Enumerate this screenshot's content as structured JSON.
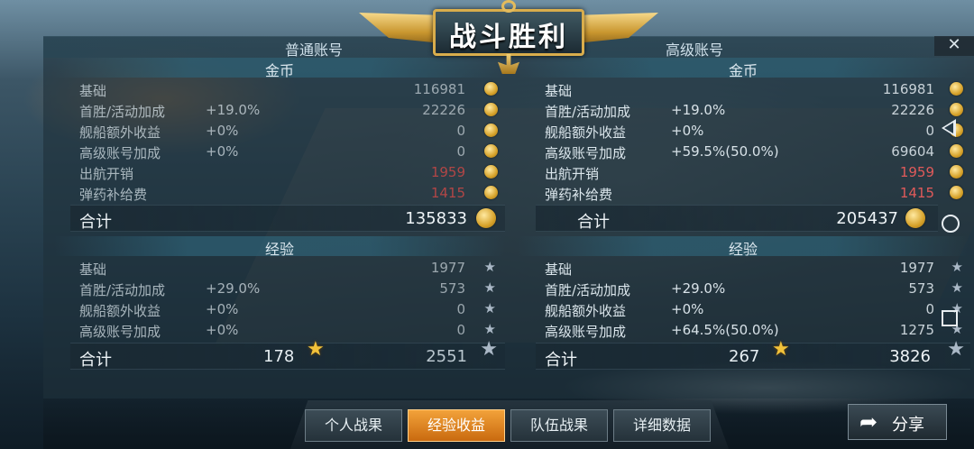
{
  "header": {
    "title": "战斗胜利",
    "normal_account": "普通账号",
    "premium_account": "高级账号",
    "close": "✕"
  },
  "gold": {
    "section": "金币",
    "normal": {
      "rows": [
        {
          "label": "基础",
          "pct": "",
          "value": "116981"
        },
        {
          "label": "首胜/活动加成",
          "pct": "+19.0%",
          "value": "22226"
        },
        {
          "label": "舰船额外收益",
          "pct": "+0%",
          "value": "0"
        },
        {
          "label": "高级账号加成",
          "pct": "+0%",
          "value": "0"
        },
        {
          "label": "出航开销",
          "pct": "",
          "value": "1959"
        },
        {
          "label": "弹药补给费",
          "pct": "",
          "value": "1415"
        }
      ],
      "total_label": "合计",
      "total": "135833"
    },
    "premium": {
      "rows": [
        {
          "label": "基础",
          "pct": "",
          "value": "116981"
        },
        {
          "label": "首胜/活动加成",
          "pct": "+19.0%",
          "value": "22226"
        },
        {
          "label": "舰船额外收益",
          "pct": "+0%",
          "value": "0"
        },
        {
          "label": "高级账号加成",
          "pct": "+59.5%(50.0%)",
          "value": "69604"
        },
        {
          "label": "出航开销",
          "pct": "",
          "value": "1959"
        },
        {
          "label": "弹药补给费",
          "pct": "",
          "value": "1415"
        }
      ],
      "total_label": "合计",
      "total": "205437"
    }
  },
  "exp": {
    "section": "经验",
    "normal": {
      "rows": [
        {
          "label": "基础",
          "pct": "",
          "value": "1977"
        },
        {
          "label": "首胜/活动加成",
          "pct": "+29.0%",
          "value": "573"
        },
        {
          "label": "舰船额外收益",
          "pct": "+0%",
          "value": "0"
        },
        {
          "label": "高级账号加成",
          "pct": "+0%",
          "value": "0"
        }
      ],
      "total_label": "合计",
      "captain_exp": "178",
      "total": "2551"
    },
    "premium": {
      "rows": [
        {
          "label": "基础",
          "pct": "",
          "value": "1977"
        },
        {
          "label": "首胜/活动加成",
          "pct": "+29.0%",
          "value": "573"
        },
        {
          "label": "舰船额外收益",
          "pct": "+0%",
          "value": "0"
        },
        {
          "label": "高级账号加成",
          "pct": "+64.5%(50.0%)",
          "value": "1275"
        }
      ],
      "total_label": "合计",
      "captain_exp": "267",
      "total": "3826"
    }
  },
  "tabs": [
    {
      "label": "个人战果",
      "active": false
    },
    {
      "label": "经验收益",
      "active": true
    },
    {
      "label": "队伍战果",
      "active": false
    },
    {
      "label": "详细数据",
      "active": false
    }
  ],
  "share": {
    "label": "分享",
    "icon": "share-back-arrow-icon"
  },
  "icons": {
    "coin": "gold-coin-icon",
    "star": "exp-star-icon",
    "nav": [
      "back-triangle-icon",
      "home-circle-icon",
      "recent-square-icon"
    ]
  },
  "colors": {
    "accent": "#f2a23a",
    "negative": "#e05a5a",
    "gold": "#d6a22a"
  }
}
